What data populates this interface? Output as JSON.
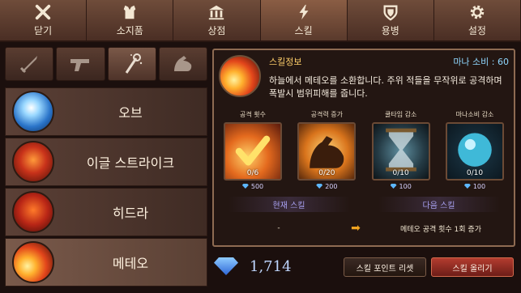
{
  "tabs": [
    {
      "label": "닫기",
      "icon": "close-x-icon"
    },
    {
      "label": "소지품",
      "icon": "armor-icon"
    },
    {
      "label": "상점",
      "icon": "shop-building-icon"
    },
    {
      "label": "스킬",
      "icon": "lightning-icon"
    },
    {
      "label": "용병",
      "icon": "shield-icon"
    },
    {
      "label": "설정",
      "icon": "gear-icon"
    }
  ],
  "active_tab": "스킬",
  "categories": [
    {
      "icon": "sword-icon"
    },
    {
      "icon": "pistol-icon"
    },
    {
      "icon": "magic-staff-icon"
    },
    {
      "icon": "flex-arm-icon"
    }
  ],
  "skills": [
    {
      "name": "오브",
      "icon": "blue-orb-icon"
    },
    {
      "name": "이글 스트라이크",
      "icon": "fire-eagle-icon"
    },
    {
      "name": "히드라",
      "icon": "fire-hydra-icon"
    },
    {
      "name": "메테오",
      "icon": "meteor-icon"
    }
  ],
  "detail": {
    "title": "스킬정보",
    "mana": "마나 소비 : 60",
    "description": "하늘에서 메테오를 소환합니다. 주위 적들을 무작위로 공격하며 폭발시 범위피해를 줍니다.",
    "upgrades": [
      {
        "title": "공격 횟수",
        "count": "0/6",
        "cost": "500",
        "icon": "checkmark-icon"
      },
      {
        "title": "공격력 증가",
        "count": "0/20",
        "cost": "200",
        "icon": "muscle-icon"
      },
      {
        "title": "쿨타임 감소",
        "count": "0/10",
        "cost": "100",
        "icon": "hourglass-icon"
      },
      {
        "title": "마나소비 감소",
        "count": "0/10",
        "cost": "100",
        "icon": "mana-orb-icon"
      }
    ],
    "current_label": "현재 스킬",
    "next_label": "다음 스킬",
    "current_effect": "-",
    "next_effect": "메테오 공격 횟수 1회 증가"
  },
  "gems": "1,714",
  "buttons": {
    "reset": "스킬 포인트 리셋",
    "upgrade": "스킬 올리기"
  }
}
